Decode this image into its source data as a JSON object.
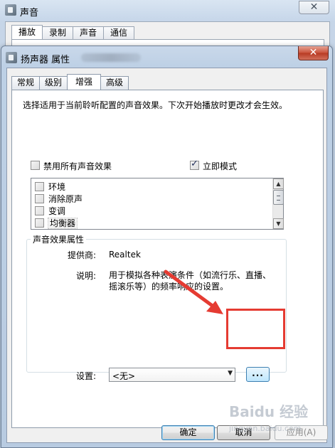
{
  "back_window": {
    "title": "声音",
    "close_glyph": "✕",
    "tabs": [
      "播放",
      "录制",
      "声音",
      "通信"
    ]
  },
  "dialog": {
    "title": "扬声器 属性",
    "close_glyph": "✕",
    "tabs": [
      "常规",
      "级别",
      "增强",
      "高级"
    ],
    "active_tab": "增强",
    "description": "选择适用于当前聆听配置的声音效果。下次开始播放时更改才会生效。",
    "disable_all_label": "禁用所有声音效果",
    "disable_all_checked": false,
    "immediate_mode_label": "立即模式",
    "immediate_mode_checked": true,
    "effects": [
      {
        "label": "环境",
        "checked": false
      },
      {
        "label": "消除原声",
        "checked": false
      },
      {
        "label": "变调",
        "checked": false
      },
      {
        "label": "均衡器",
        "checked": false
      }
    ],
    "scroll_up": "▲",
    "scroll_down": "▼",
    "properties": {
      "legend": "声音效果属性",
      "provider_label": "提供商:",
      "provider_value": "Realtek",
      "description_label": "说明:",
      "description_value": "用于模拟各种表演条件（如流行乐、直播、摇滚乐等）的频率响应的设置。",
      "setting_label": "设置:",
      "setting_value": "<无>",
      "setting_arrow": "▼",
      "ellipsis_label": "..."
    },
    "buttons": {
      "ok": "确定",
      "cancel": "取消",
      "apply": "应用(A)"
    }
  },
  "watermark": {
    "text": "Baidu 经验",
    "url": "jingyan.baidu.com"
  },
  "colors": {
    "annotation_red": "#e53b32",
    "close_red": "#c9513a"
  }
}
